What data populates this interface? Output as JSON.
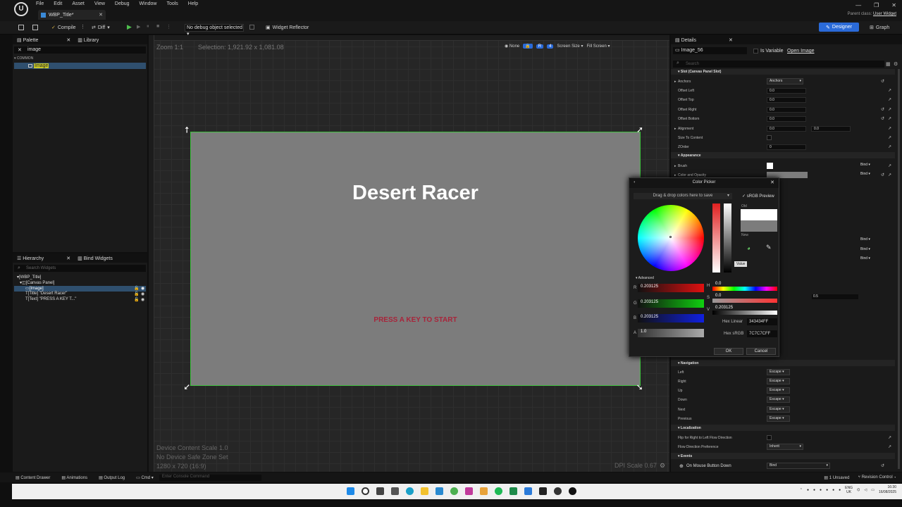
{
  "app": {
    "tab_title": "WBP_Title*",
    "parent_class_label": "Parent class:",
    "parent_class_value": "User Widget"
  },
  "menu": [
    "File",
    "Edit",
    "Asset",
    "View",
    "Debug",
    "Window",
    "Tools",
    "Help"
  ],
  "toolbar": {
    "compile": "Compile",
    "diff": "Diff",
    "debug_select": "No debug object selected",
    "widget_reflector": "Widget Reflector",
    "designer": "Designer",
    "graph": "Graph"
  },
  "palette": {
    "tab": "Palette",
    "library_tab": "Library",
    "search_value": "image",
    "category": "COMMON",
    "item": "Image"
  },
  "hierarchy": {
    "tab": "Hierarchy",
    "bind_tab": "Bind Widgets",
    "search_placeholder": "Search Widgets",
    "items": [
      "[WBP_Title]",
      "[Canvas Panel]",
      "[Image]",
      "[Title] \"Desert Racer\"",
      "[Text] \"PRESS A KEY T...\""
    ]
  },
  "viewport": {
    "zoom": "Zoom 1:1",
    "selection": "Selection: 1,921.92 x 1,081.08",
    "none": "None",
    "r_label": "R",
    "num_label": "4",
    "screen_size": "Screen Size",
    "fill_screen": "Fill Screen",
    "title_text": "Desert Racer",
    "press_text": "PRESS A KEY TO START",
    "device_scale": "Device Content Scale 1.0",
    "safe_zone": "No Device Safe Zone Set",
    "resolution": "1280 x 720 (16:9)",
    "dpi": "DPI Scale 0.67"
  },
  "details": {
    "tab": "Details",
    "name": "Image_56",
    "is_variable": "Is Variable",
    "open_image": "Open Image",
    "search_placeholder": "Search",
    "slot_header": "Slot (Canvas Panel Slot)",
    "rows": [
      {
        "label": "Anchors",
        "value": "Anchors",
        "type": "dropdown"
      },
      {
        "label": "Offset Left",
        "value": "0.0",
        "type": "value"
      },
      {
        "label": "Offset Top",
        "value": "0.0",
        "type": "value"
      },
      {
        "label": "Offset Right",
        "value": "0.0",
        "type": "value"
      },
      {
        "label": "Offset Bottom",
        "value": "0.0",
        "type": "value"
      },
      {
        "label": "Alignment",
        "value": "0.0",
        "value2": "0.0",
        "type": "value"
      },
      {
        "label": "Size To Content",
        "value": "",
        "type": "check"
      },
      {
        "label": "ZOrder",
        "value": "0",
        "type": "value"
      }
    ],
    "appearance": "Appearance",
    "brush": "Brush",
    "color_opacity": "Color and Opacity",
    "bind": "Bind",
    "extra_value": "0.5",
    "navigation": "Navigation",
    "nav_rows": [
      {
        "label": "Left",
        "value": "Escape"
      },
      {
        "label": "Right",
        "value": "Escape"
      },
      {
        "label": "Up",
        "value": "Escape"
      },
      {
        "label": "Down",
        "value": "Escape"
      },
      {
        "label": "Next",
        "value": "Escape"
      },
      {
        "label": "Previous",
        "value": "Escape"
      }
    ],
    "localization": "Localization",
    "flip_label": "Flip for Right to Left Flow Direction",
    "flow_label": "Flow Direction Preference",
    "flow_value": "Inherit",
    "events": "Events",
    "event_label": "On Mouse Button Down",
    "event_value": "Bind"
  },
  "picker": {
    "title": "Color Picker",
    "drag_text": "Drag & drop colors here to save",
    "srgb": "sRGB Preview",
    "old": "Old",
    "new": "New",
    "tooltip": "Value",
    "advanced": "Advanced",
    "r": "0.203125",
    "g": "0.203125",
    "b": "0.203125",
    "a": "1.0",
    "h": "0.0",
    "s": "0.0",
    "v": "0.203125",
    "r_label": "R",
    "g_label": "G",
    "b_label": "B",
    "a_label": "A",
    "h_label": "H",
    "s_label": "S",
    "v_label": "V",
    "hex_linear_label": "Hex Linear",
    "hex_linear": "343434FF",
    "hex_srgb_label": "Hex sRGB",
    "hex_srgb": "7C7C7CFF",
    "ok": "OK",
    "cancel": "Cancel"
  },
  "statusbar": {
    "content_drawer": "Content Drawer",
    "animations": "Animations",
    "output_log": "Output Log",
    "cmd": "Cmd",
    "console_placeholder": "Enter Console Command",
    "unsaved": "1 Unsaved",
    "revision": "Revision Control"
  },
  "taskbar": {
    "lang1": "ENG",
    "lang2": "UK",
    "time": "16:30",
    "date": "16/08/2025"
  }
}
